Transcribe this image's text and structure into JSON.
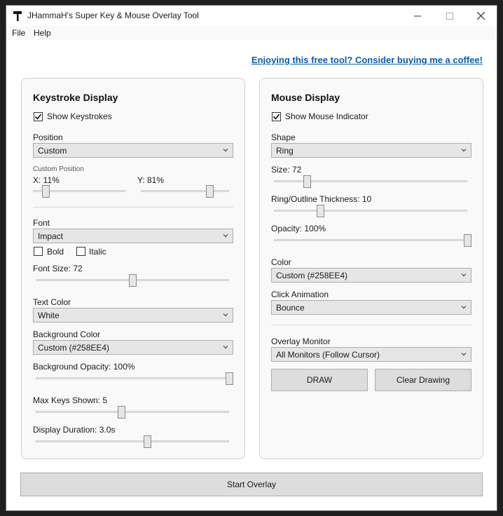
{
  "window": {
    "title": "JHammaH's Super Key & Mouse Overlay Tool"
  },
  "menu": [
    "File",
    "Help"
  ],
  "coffee_link": "Enjoying this free tool? Consider buying me a coffee!",
  "keystroke": {
    "heading": "Keystroke Display",
    "show_label": "Show Keystrokes",
    "show_checked": true,
    "position_label": "Position",
    "position_value": "Custom",
    "custom_position_label": "Custom Position",
    "x_label": "X: 11%",
    "x_value": 0.11,
    "y_label": "Y: 81%",
    "y_value": 0.81,
    "font_label": "Font",
    "font_value": "Impact",
    "bold_label": "Bold",
    "italic_label": "Italic",
    "font_size_label": "Font Size: 72",
    "font_size_value": 0.5,
    "text_color_label": "Text Color",
    "text_color_value": "White",
    "bg_color_label": "Background Color",
    "bg_color_value": "Custom (#258EE4)",
    "bg_opacity_label": "Background Opacity: 100%",
    "bg_opacity_value": 1.0,
    "max_keys_label": "Max Keys Shown: 5",
    "max_keys_value": 0.44,
    "duration_label": "Display Duration: 3.0s",
    "duration_value": 0.58
  },
  "mouse": {
    "heading": "Mouse Display",
    "show_label": "Show Mouse Indicator",
    "show_checked": true,
    "shape_label": "Shape",
    "shape_value": "Ring",
    "size_label": "Size: 72",
    "size_value": 0.16,
    "thickness_label": "Ring/Outline Thickness: 10",
    "thickness_value": 0.23,
    "opacity_label": "Opacity: 100%",
    "opacity_value": 1.0,
    "color_label": "Color",
    "color_value": "Custom (#258EE4)",
    "click_anim_label": "Click Animation",
    "click_anim_value": "Bounce",
    "monitor_label": "Overlay Monitor",
    "monitor_value": "All Monitors (Follow Cursor)",
    "draw_label": "DRAW",
    "clear_label": "Clear Drawing"
  },
  "start_label": "Start Overlay",
  "colors": {
    "link": "#0b5cad",
    "panel_bg": "#f9f9f9",
    "button_bg": "#dddddd"
  }
}
